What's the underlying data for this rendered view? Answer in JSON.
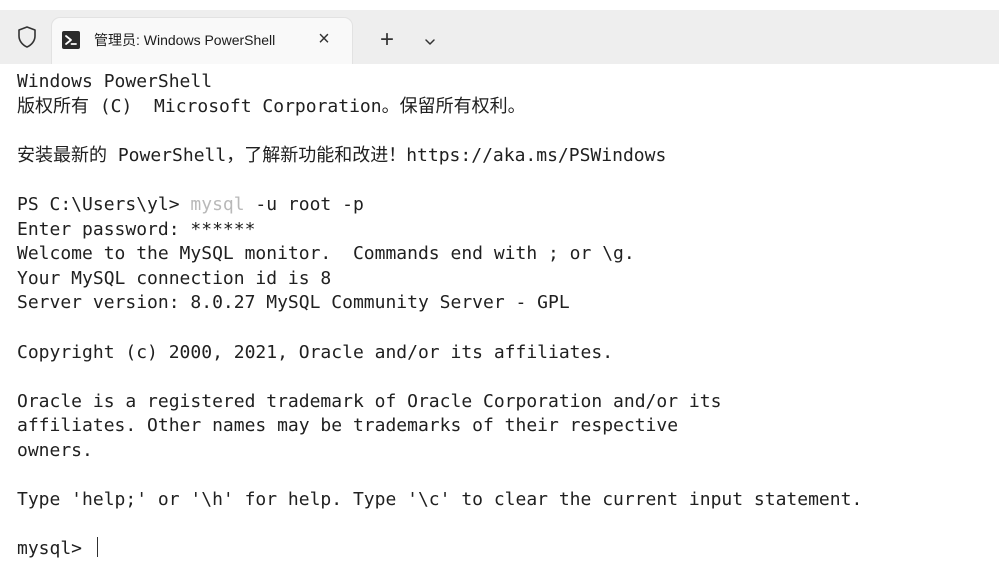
{
  "tab": {
    "title": "管理员: Windows PowerShell",
    "close_glyph": "×",
    "new_tab_glyph": "+",
    "dropdown_icon": "chevron-down-icon",
    "shield_icon": "shield-icon"
  },
  "terminal": {
    "line_header_1": "Windows PowerShell",
    "line_header_2": "版权所有 (C)  Microsoft Corporation。保留所有权利。",
    "line_install": "安装最新的 PowerShell，了解新功能和改进！https://aka.ms/PSWindows",
    "prompt_prefix": "PS C:\\Users\\yl> ",
    "prompt_command": "mysql",
    "prompt_args": " -u root -p",
    "line_password": "Enter password: ******",
    "line_welcome": "Welcome to the MySQL monitor.  Commands end with ; or \\g.",
    "line_conn_id": "Your MySQL connection id is 8",
    "line_server_version": "Server version: 8.0.27 MySQL Community Server - GPL",
    "line_copyright": "Copyright (c) 2000, 2021, Oracle and/or its affiliates.",
    "line_trademark_1": "Oracle is a registered trademark of Oracle Corporation and/or its",
    "line_trademark_2": "affiliates. Other names may be trademarks of their respective",
    "line_trademark_3": "owners.",
    "line_help": "Type 'help;' or '\\h' for help. Type '\\c' to clear the current input statement.",
    "mysql_prompt": "mysql> "
  }
}
